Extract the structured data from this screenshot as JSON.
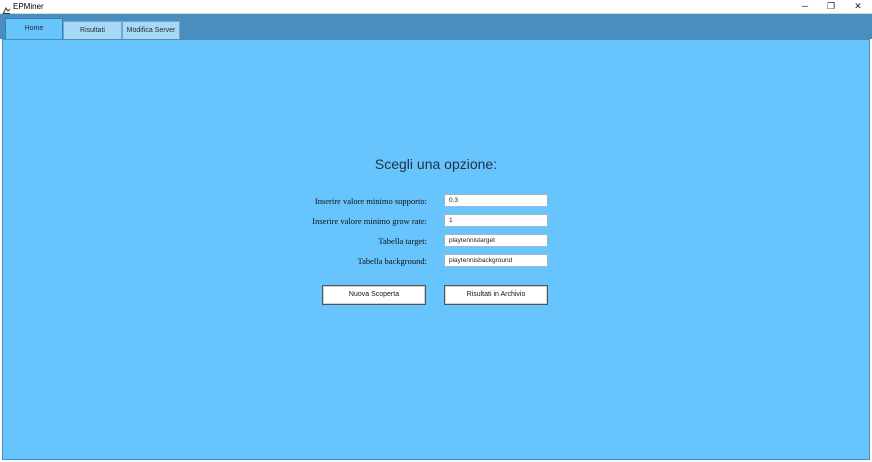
{
  "window": {
    "title": "EPMiner",
    "minimize": "─",
    "maximize": "❐",
    "close": "✕"
  },
  "tabs": [
    {
      "label": "Home",
      "active": true
    },
    {
      "label": "Risultati",
      "active": false
    },
    {
      "label": "Modifica Server",
      "active": false
    }
  ],
  "home": {
    "heading": "Scegli una opzione:",
    "fields": [
      {
        "label": "Inserire valore minimo supporto:",
        "value": "0.3"
      },
      {
        "label": "Inserire valore minimo grow rate:",
        "value": "1"
      },
      {
        "label": "Tabella target:",
        "value": "playtennistarget"
      },
      {
        "label": "Tabella background:",
        "value": "playtennisbackground"
      }
    ],
    "buttons": {
      "nuova_scoperta": "Nuova Scoperta",
      "risultati_archivio": "Risultati in Archivio"
    }
  },
  "colors": {
    "panel": "#67c4fd",
    "tabstrip": "#4a8dbf"
  }
}
